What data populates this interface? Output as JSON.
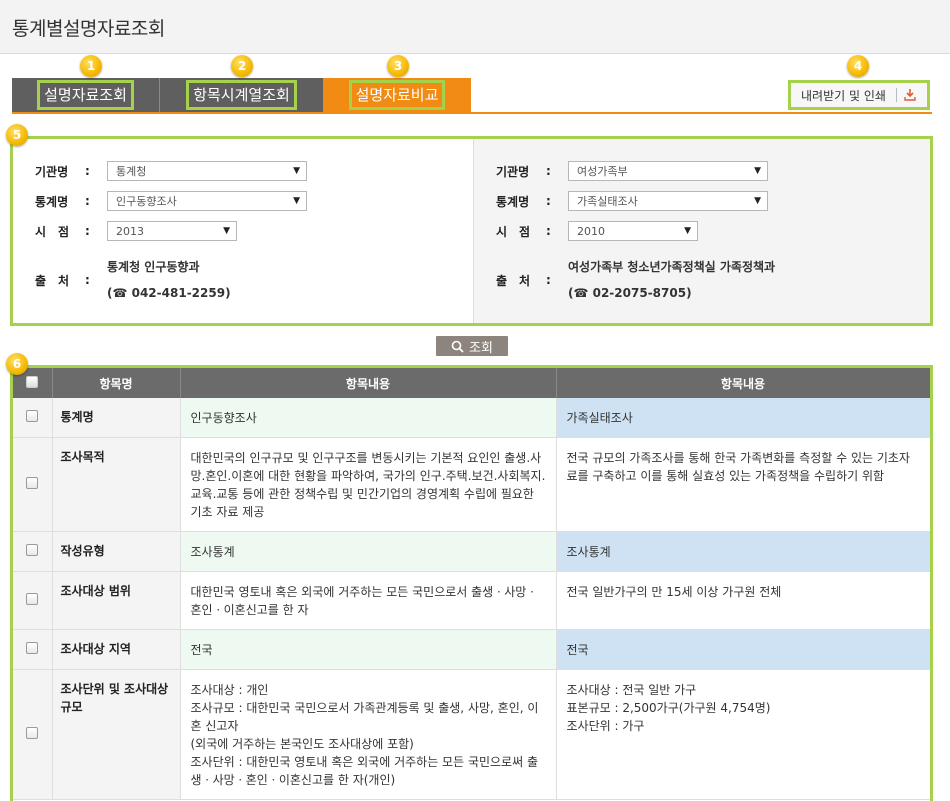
{
  "page": {
    "title": "통계별설명자료조회"
  },
  "tabs": [
    {
      "label": "설명자료조회",
      "badge": "1"
    },
    {
      "label": "항목시계열조회",
      "badge": "2"
    },
    {
      "label": "설명자료비교",
      "badge": "3"
    }
  ],
  "download": {
    "label": "내려받기 및 인쇄",
    "badge": "4"
  },
  "filters": {
    "badge": "5",
    "labels": {
      "org": "기관명",
      "stat": "통계명",
      "time": "시　점",
      "source": "출　처",
      "colon": ":"
    },
    "left": {
      "org": "통계청",
      "stat": "인구동향조사",
      "year": "2013",
      "source_name": "통계청 인구동향과",
      "phone": "(☎ 042-481-2259)"
    },
    "right": {
      "org": "여성가족부",
      "stat": "가족실태조사",
      "year": "2010",
      "source_name": "여성가족부 청소년가족정책실 가족정책과",
      "phone": "(☎ 02-2075-8705)"
    }
  },
  "search": {
    "label": "조회"
  },
  "table": {
    "badge": "6",
    "headers": [
      "항목명",
      "항목내용",
      "항목내용"
    ],
    "rows": [
      {
        "name": "통계명",
        "left": "인구동향조사",
        "right": "가족실태조사",
        "shade": true
      },
      {
        "name": "조사목적",
        "left": "대한민국의 인구규모 및 인구구조를 변동시키는 기본적 요인인 출생.사망.혼인.이혼에 대한 현황을 파악하여, 국가의 인구.주택.보건.사회복지.교육.교통 등에 관한 정책수립 및 민간기업의 경영계획 수립에 필요한 기초 자료 제공",
        "right": "전국 규모의 가족조사를 통해 한국 가족변화를 측정할 수 있는 기초자료를 구축하고 이를 통해 실효성 있는 가족정책을 수립하기 위함",
        "shade": false
      },
      {
        "name": "작성유형",
        "left": "조사통계",
        "right": "조사통계",
        "shade": true
      },
      {
        "name": "조사대상 범위",
        "left": "대한민국 영토내 혹은 외국에 거주하는 모든 국민으로서 출생ㆍ사망ㆍ혼인ㆍ이혼신고를 한 자",
        "right": "전국 일반가구의 만 15세 이상 가구원 전체",
        "shade": false
      },
      {
        "name": "조사대상 지역",
        "left": "전국",
        "right": "전국",
        "shade": true
      },
      {
        "name": "조사단위 및 조사대상 규모",
        "left": "조사대상 : 개인\n조사규모 : 대한민국 국민으로서 가족관계등록 및 출생, 사망, 혼인, 이혼 신고자\n(외국에 거주하는 본국인도 조사대상에 포함)\n조사단위 : 대한민국 영토내 혹은 외국에 거주하는 모든 국민으로써 출생ㆍ사망ㆍ혼인ㆍ이혼신고를 한 자(개인)",
        "right": "조사대상 : 전국 일반 가구\n표본규모 : 2,500가구(가구원 4,754명)\n조사단위 : 가구",
        "shade": false
      }
    ]
  },
  "colors": {
    "orange": "#f28b14",
    "highlight": "#a6d14b",
    "tab_gray": "#5f5f5f",
    "header_gray": "#6b6b6b",
    "left_shade": "#eefaf1",
    "right_shade": "#cfe2f4"
  },
  "icons": {
    "download": "download-icon",
    "search": "magnifier-icon",
    "phone": "phone-icon"
  }
}
